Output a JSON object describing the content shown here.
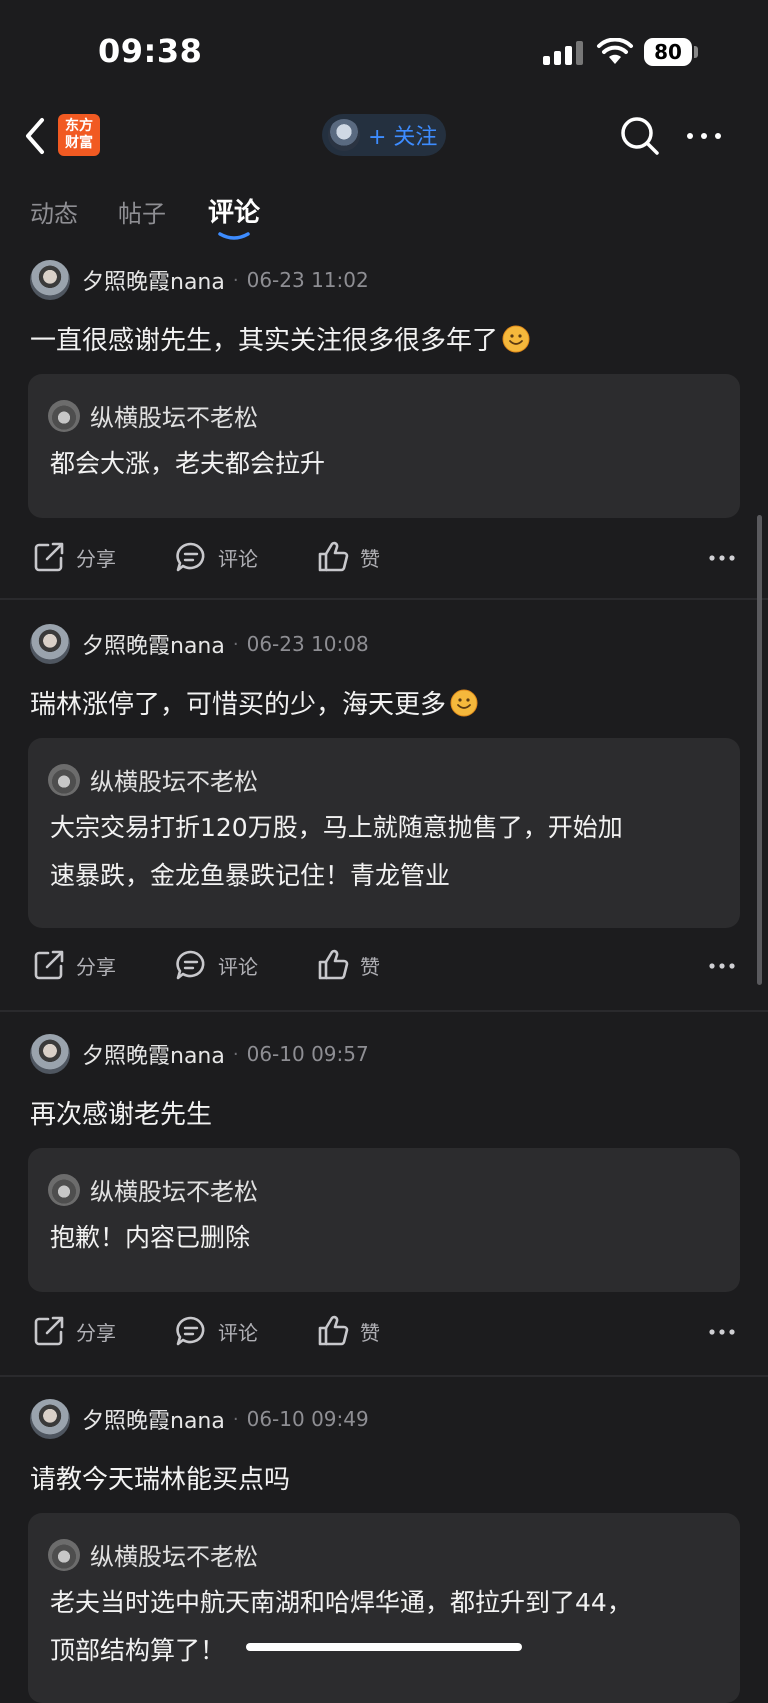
{
  "status": {
    "time": "09:38",
    "battery": "80"
  },
  "nav": {
    "logo_line1": "东方",
    "logo_line2": "财富",
    "follow_label": "+ 关注"
  },
  "tabs": [
    {
      "label": "动态",
      "active": false
    },
    {
      "label": "帖子",
      "active": false
    },
    {
      "label": "评论",
      "active": true
    }
  ],
  "actions": {
    "share": "分享",
    "comment": "评论",
    "like": "赞"
  },
  "comments": [
    {
      "user": "夕照晚霞nana",
      "time": "06-23 11:02",
      "text": "一直很感谢先生，其实关注很多很多年了",
      "has_emoji": true,
      "reply": {
        "user": "纵横股坛不老松",
        "lines": [
          "都会大涨，老夫都会拉升"
        ]
      }
    },
    {
      "user": "夕照晚霞nana",
      "time": "06-23 10:08",
      "text": "瑞林涨停了，可惜买的少，海天更多",
      "has_emoji": true,
      "reply": {
        "user": "纵横股坛不老松",
        "lines": [
          "大宗交易打折120万股，马上就随意抛售了，开始加",
          "速暴跌，金龙鱼暴跌记住！青龙管业"
        ]
      }
    },
    {
      "user": "夕照晚霞nana",
      "time": "06-10 09:57",
      "text": "再次感谢老先生",
      "has_emoji": false,
      "reply": {
        "user": "纵横股坛不老松",
        "lines": [
          "抱歉！内容已删除"
        ]
      }
    },
    {
      "user": "夕照晚霞nana",
      "time": "06-10 09:49",
      "text": "请教今天瑞林能买点吗",
      "has_emoji": false,
      "reply": {
        "user": "纵横股坛不老松",
        "lines": [
          "老夫当时选中航天南湖和哈焊华通，都拉升到了44，",
          "顶部结构算了！"
        ]
      }
    }
  ]
}
